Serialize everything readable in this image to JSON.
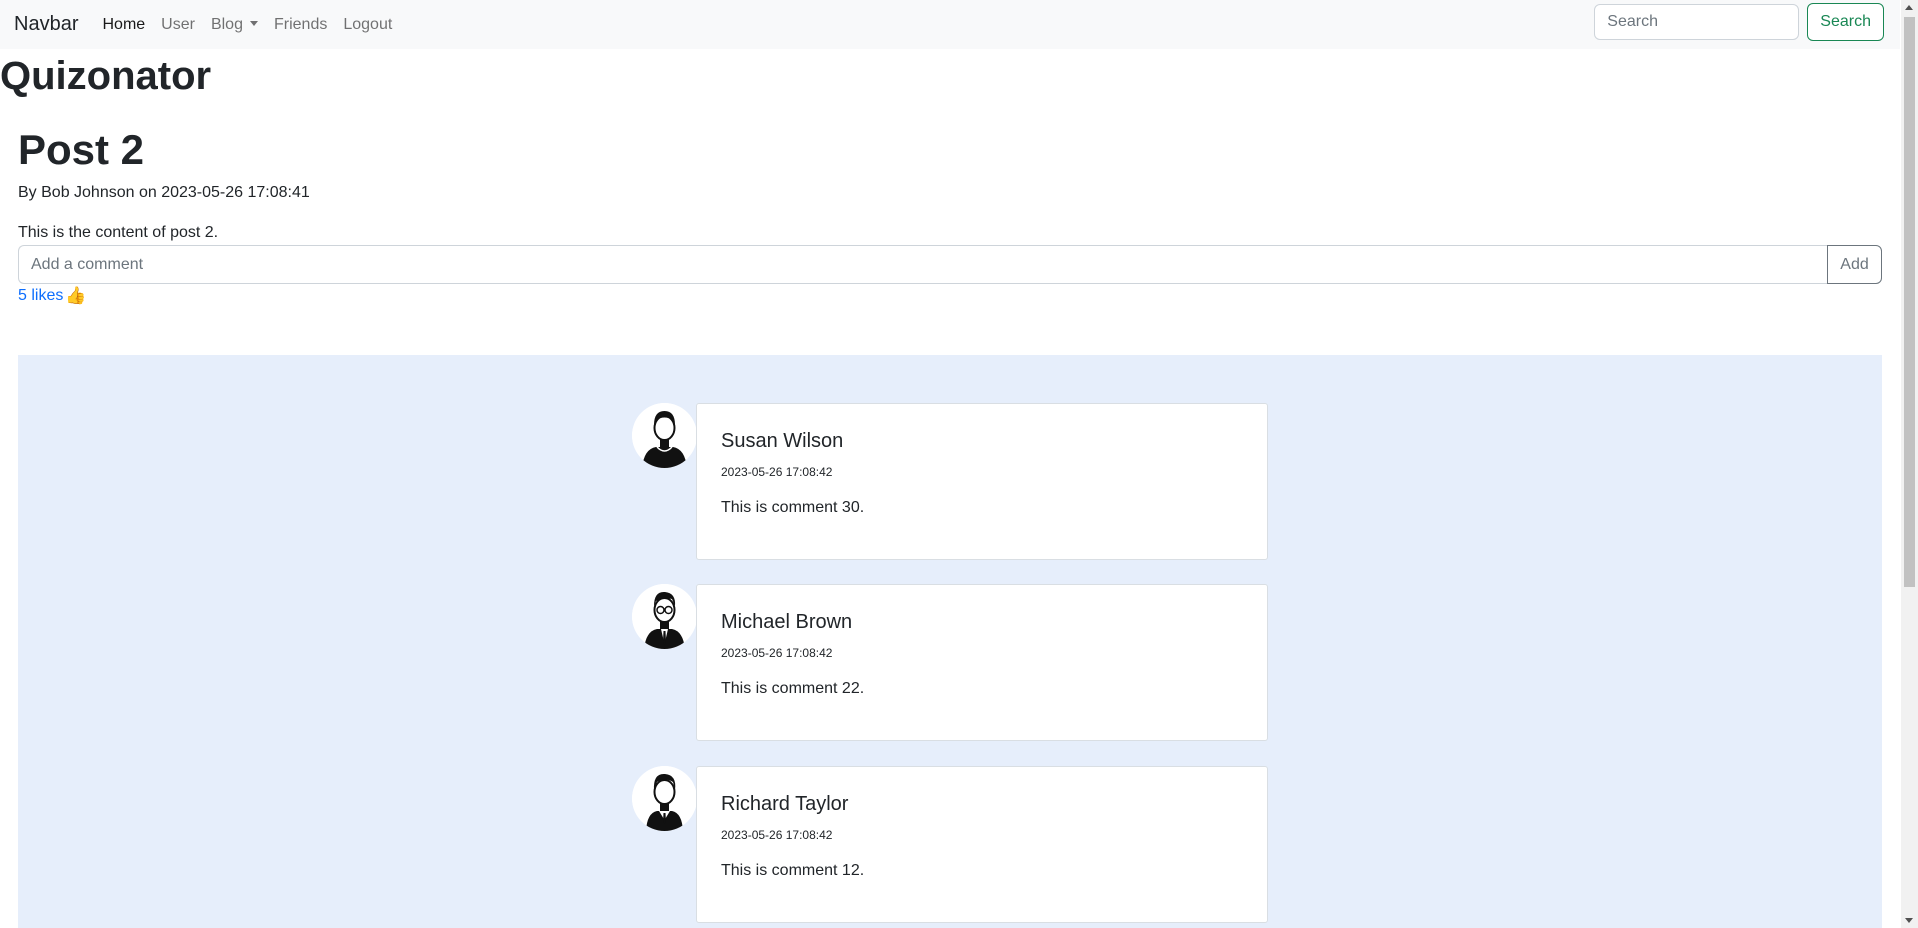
{
  "navbar": {
    "brand": "Navbar",
    "links": [
      {
        "label": "Home",
        "active": true
      },
      {
        "label": "User"
      },
      {
        "label": "Blog"
      },
      {
        "label": "Friends"
      },
      {
        "label": "Logout"
      }
    ],
    "search_placeholder": "Search",
    "search_button": "Search"
  },
  "site_title": "Quizonator",
  "post": {
    "title": "Post 2",
    "byline": "By Bob Johnson on 2023-05-26 17:08:41",
    "content": "This is the content of post 2.",
    "comment_placeholder": "Add a comment",
    "add_button": "Add",
    "likes": "5 likes",
    "like_icon": "👍"
  },
  "comments": [
    {
      "name": "Susan Wilson",
      "date": "2023-05-26 17:08:42",
      "text": "This is comment 30.",
      "avatar": "man-tshirt-avatar-icon"
    },
    {
      "name": "Michael Brown",
      "date": "2023-05-26 17:08:42",
      "text": "This is comment 22.",
      "avatar": "man-glasses-suit-avatar-icon"
    },
    {
      "name": "Richard Taylor",
      "date": "2023-05-26 17:08:42",
      "text": "This is comment 12.",
      "avatar": "man-vest-tie-avatar-icon"
    }
  ],
  "colors": {
    "accent_green": "#198754",
    "link_blue": "#0d6efd",
    "comments_bg": "#e6eefb"
  }
}
